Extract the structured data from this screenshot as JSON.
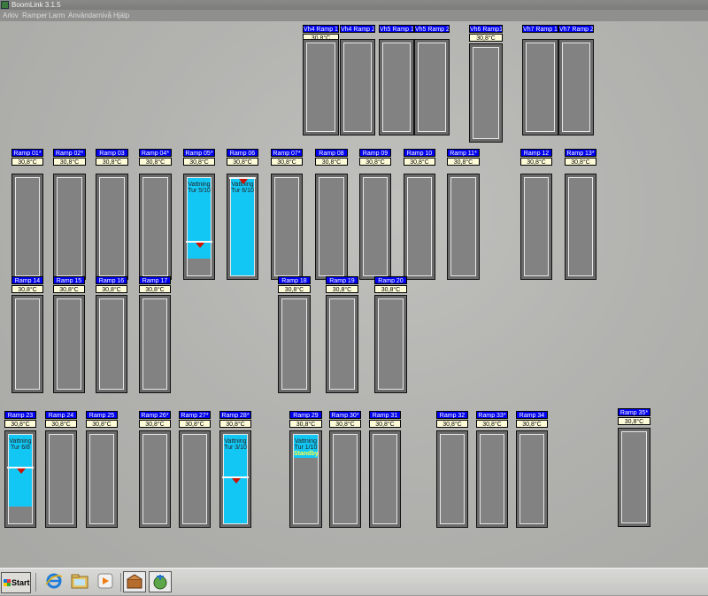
{
  "app": {
    "title": "BoomLink 3.1.5"
  },
  "menu": [
    "Arkiv",
    "Ramper",
    "Larm",
    "Användarnivå",
    "Hjälp"
  ],
  "status_labels": {
    "drying": "Vattning",
    "standby": "Standby"
  },
  "colors": {
    "name_bg": "#0000ee",
    "temp_bg": "#fdfbd8",
    "water_fill": "#13c7f5",
    "marker": "#cc1100"
  },
  "ramps": [
    {
      "name": "Vh4 Ramp 1",
      "temp": "30,8°C",
      "fill": 0
    },
    {
      "name": "Vh4 Ramp 2",
      "temp": "",
      "fill": 0
    },
    {
      "name": "Vh5 Ramp 1",
      "temp": "",
      "fill": 0
    },
    {
      "name": "Vh5 Ramp 2",
      "temp": "",
      "fill": 0
    },
    {
      "name": "Vh6 Ramp1",
      "temp": "30,8°C",
      "fill": 0
    },
    {
      "name": "Vh7 Ramp 1",
      "temp": "",
      "fill": 0
    },
    {
      "name": "Vh7 Ramp 2",
      "temp": "",
      "fill": 0
    },
    {
      "name": "Ramp 01*",
      "temp": "30,8°C",
      "fill": 0
    },
    {
      "name": "Ramp 02*",
      "temp": "30,8°C",
      "fill": 0
    },
    {
      "name": "Ramp 03",
      "temp": "30,8°C",
      "fill": 0
    },
    {
      "name": "Ramp 04*",
      "temp": "30,8°C",
      "fill": 0
    },
    {
      "name": "Ramp 05*",
      "temp": "30,8°C",
      "fill": 0.8,
      "status": "Vattning",
      "detail": "Tur 5/10",
      "marker": 0.63
    },
    {
      "name": "Ramp 06",
      "temp": "30,8°C",
      "fill": 1.0,
      "status": "Vattning",
      "detail": "Tur 6/10",
      "marker": 0.0
    },
    {
      "name": "Ramp 07*",
      "temp": "30,8°C",
      "fill": 0
    },
    {
      "name": "Ramp 08",
      "temp": "30,8°C",
      "fill": 0
    },
    {
      "name": "Ramp 09",
      "temp": "30,8°C",
      "fill": 0
    },
    {
      "name": "Ramp 10",
      "temp": "30,8°C",
      "fill": 0
    },
    {
      "name": "Ramp 11*",
      "temp": "30,8°C",
      "fill": 0
    },
    {
      "name": "Ramp 12",
      "temp": "30,8°C",
      "fill": 0
    },
    {
      "name": "Ramp 13*",
      "temp": "30,8°C",
      "fill": 0
    },
    {
      "name": "Ramp 14",
      "temp": "30,8°C",
      "fill": 0
    },
    {
      "name": "Ramp 15",
      "temp": "30,8°C",
      "fill": 0
    },
    {
      "name": "Ramp 16",
      "temp": "30,8°C",
      "fill": 0
    },
    {
      "name": "Ramp 17",
      "temp": "30,8°C",
      "fill": 0
    },
    {
      "name": "Ramp 18",
      "temp": "30,8°C",
      "fill": 0
    },
    {
      "name": "Ramp 19",
      "temp": "30,8°C",
      "fill": 0
    },
    {
      "name": "Ramp 20",
      "temp": "30,8°C",
      "fill": 0
    },
    {
      "name": "Ramp 23",
      "temp": "30,8°C",
      "fill": 0.78,
      "status": "Vattning",
      "detail": "Tur 6/8",
      "marker": 0.36
    },
    {
      "name": "Ramp 24",
      "temp": "30,8°C",
      "fill": 0
    },
    {
      "name": "Ramp 25",
      "temp": "30,8°C",
      "fill": 0
    },
    {
      "name": "Ramp 26*",
      "temp": "30,8°C",
      "fill": 0
    },
    {
      "name": "Ramp 27*",
      "temp": "30,8°C",
      "fill": 0
    },
    {
      "name": "Ramp 28*",
      "temp": "30,8°C",
      "fill": 1.0,
      "status": "Vattning",
      "detail": "Tur 3/10",
      "marker": 0.46
    },
    {
      "name": "Ramp 29",
      "temp": "30,8°C",
      "fill": 0.25,
      "status": "Vattning",
      "detail": "Tur 1/10",
      "extra": "Standby"
    },
    {
      "name": "Ramp 30*",
      "temp": "30,8°C",
      "fill": 0
    },
    {
      "name": "Ramp 31",
      "temp": "30,8°C",
      "fill": 0
    },
    {
      "name": "Ramp 32",
      "temp": "30,8°C",
      "fill": 0
    },
    {
      "name": "Ramp 33*",
      "temp": "30,8°C",
      "fill": 0
    },
    {
      "name": "Ramp 34",
      "temp": "30,8°C",
      "fill": 0
    },
    {
      "name": "Ramp 35*",
      "temp": "30,8°C",
      "fill": 0
    }
  ],
  "taskbar": {
    "start_label": "Start",
    "icons": [
      "ie-icon",
      "folder-icon",
      "media-player-icon",
      "boomlink-tray-icon",
      "boomlink-app-icon"
    ]
  }
}
